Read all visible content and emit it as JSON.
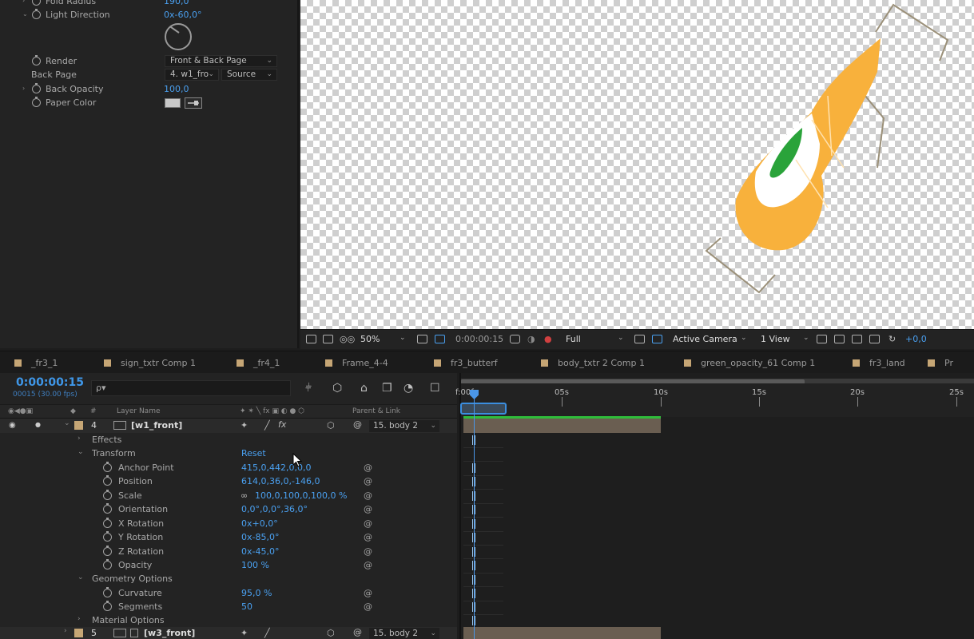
{
  "effect_controls": {
    "props": [
      {
        "name": "Fold Radius",
        "value": "190,0"
      },
      {
        "name": "Light Direction",
        "value": "0x-60,0°"
      },
      {
        "name": "Render",
        "value": "Front & Back Page"
      },
      {
        "name": "Back Page",
        "value": "4. w1_fro",
        "value2": "Source"
      },
      {
        "name": "Back Opacity",
        "value": "100,0"
      },
      {
        "name": "Paper Color",
        "value": ""
      }
    ]
  },
  "viewer_toolbar": {
    "zoom": "50%",
    "timecode": "0:00:00:15",
    "resolution": "Full",
    "camera": "Active Camera",
    "views": "1 View",
    "exposure": "+0,0"
  },
  "tabs": [
    "_fr3_1",
    "sign_txtr Comp 1",
    "_fr4_1",
    "Frame_4-4",
    "fr3_butterf",
    "body_txtr 2 Comp 1",
    "green_opacity_61 Comp 1",
    "fr3_land",
    "Pr"
  ],
  "timeline": {
    "timecode": "0:00:00:15",
    "timecode_sub": "00015 (30.00 fps)",
    "search_placeholder": "ρ▾",
    "header": {
      "num": "#",
      "layer_name": "Layer Name",
      "parent": "Parent & Link"
    },
    "ruler": [
      "f:00f",
      "05s",
      "10s",
      "15s",
      "20s",
      "25s"
    ],
    "layers": [
      {
        "num": "4",
        "name": "[w1_front]",
        "parent": "15. body 2"
      },
      {
        "num": "5",
        "name": "[w3_front]",
        "parent": "15. body 2"
      }
    ],
    "groups": {
      "effects": "Effects",
      "transform": "Transform",
      "reset": "Reset",
      "geometry": "Geometry Options",
      "material": "Material Options"
    },
    "transform": [
      {
        "name": "Anchor Point",
        "value": "415,0,442,0,0,0"
      },
      {
        "name": "Position",
        "value": "614,0,36,0,-146,0"
      },
      {
        "name": "Scale",
        "value": "100,0,100,0,100,0 %"
      },
      {
        "name": "Orientation",
        "value": "0,0°,0,0°,36,0°"
      },
      {
        "name": "X Rotation",
        "value": "0x+0,0°"
      },
      {
        "name": "Y Rotation",
        "value": "0x-85,0°"
      },
      {
        "name": "Z Rotation",
        "value": "0x-45,0°"
      },
      {
        "name": "Opacity",
        "value": "100 %"
      }
    ],
    "geometry": [
      {
        "name": "Curvature",
        "value": "95,0 %"
      },
      {
        "name": "Segments",
        "value": "50"
      }
    ]
  }
}
